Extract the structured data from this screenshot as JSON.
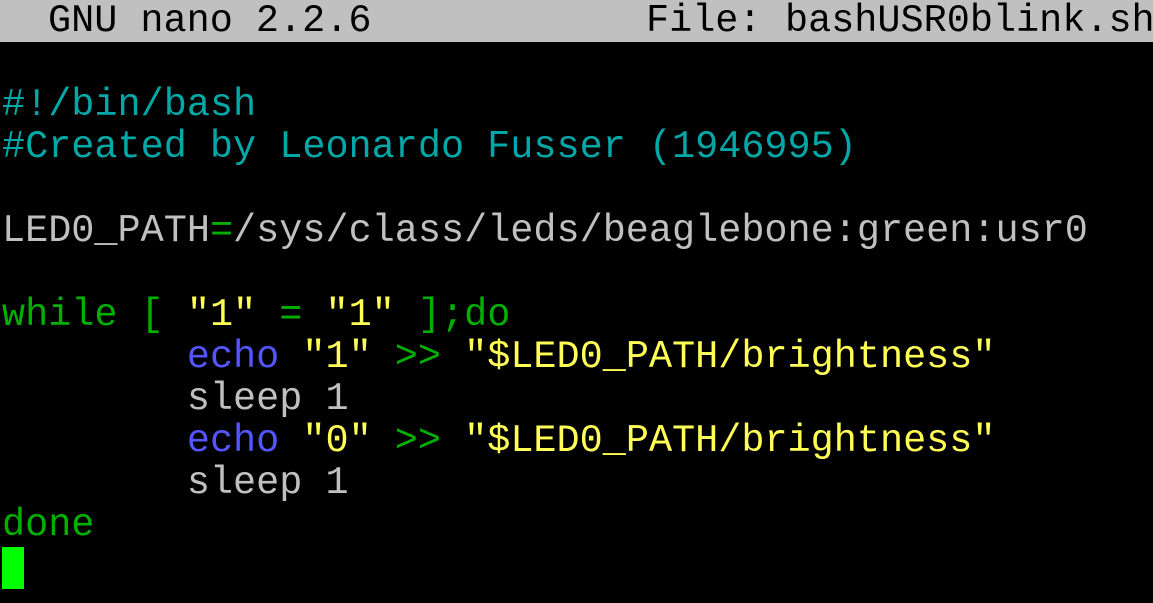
{
  "titlebar": {
    "app": "GNU nano 2.2.6",
    "file_label": "File:",
    "file_name": "bashUSR0blink.sh"
  },
  "colors": {
    "background": "#000000",
    "titlebar_bg": "#c0c0c0",
    "comment": "#00a8a8",
    "default_text": "#c0c0c0",
    "keyword": "#00b000",
    "string": "#ffff55",
    "builtin": "#5555ff",
    "cursor": "#00ff00"
  },
  "lines": [
    {
      "name": "line-shebang",
      "tokens": [
        {
          "t": "#!/bin/bash",
          "c": "#00a8a8"
        }
      ]
    },
    {
      "name": "line-comment-author",
      "tokens": [
        {
          "t": "#Created by Leonardo Fusser (1946995)",
          "c": "#00a8a8"
        }
      ]
    },
    {
      "name": "line-blank-1",
      "tokens": []
    },
    {
      "name": "line-assignment",
      "tokens": [
        {
          "t": "LED0_PATH",
          "c": "#c0c0c0"
        },
        {
          "t": "=",
          "c": "#00b000"
        },
        {
          "t": "/sys/class/leds/beaglebone:green:usr0",
          "c": "#c0c0c0"
        }
      ]
    },
    {
      "name": "line-blank-2",
      "tokens": []
    },
    {
      "name": "line-while",
      "tokens": [
        {
          "t": "while [ ",
          "c": "#00b000"
        },
        {
          "t": "\"1\"",
          "c": "#ffff55"
        },
        {
          "t": " = ",
          "c": "#00b000"
        },
        {
          "t": "\"1\"",
          "c": "#ffff55"
        },
        {
          "t": " ];do",
          "c": "#00b000"
        }
      ]
    },
    {
      "name": "line-echo-1",
      "tokens": [
        {
          "t": "        ",
          "c": "#c0c0c0"
        },
        {
          "t": "echo",
          "c": "#5555ff"
        },
        {
          "t": " ",
          "c": "#c0c0c0"
        },
        {
          "t": "\"1\"",
          "c": "#ffff55"
        },
        {
          "t": " >> ",
          "c": "#00b000"
        },
        {
          "t": "\"$LED0_PATH/brightness\"",
          "c": "#ffff55"
        }
      ]
    },
    {
      "name": "line-sleep-1",
      "tokens": [
        {
          "t": "        sleep 1",
          "c": "#c0c0c0"
        }
      ]
    },
    {
      "name": "line-echo-0",
      "tokens": [
        {
          "t": "        ",
          "c": "#c0c0c0"
        },
        {
          "t": "echo",
          "c": "#5555ff"
        },
        {
          "t": " ",
          "c": "#c0c0c0"
        },
        {
          "t": "\"0\"",
          "c": "#ffff55"
        },
        {
          "t": " >> ",
          "c": "#00b000"
        },
        {
          "t": "\"$LED0_PATH/brightness\"",
          "c": "#ffff55"
        }
      ]
    },
    {
      "name": "line-sleep-2",
      "tokens": [
        {
          "t": "        sleep 1",
          "c": "#c0c0c0"
        }
      ]
    },
    {
      "name": "line-done",
      "tokens": [
        {
          "t": "done",
          "c": "#00b000"
        }
      ]
    }
  ]
}
